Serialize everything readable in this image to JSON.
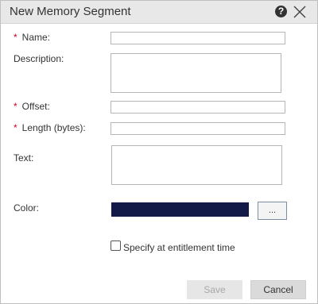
{
  "dialog": {
    "title": "New Memory Segment",
    "help_icon": "question-circle-icon",
    "help_glyph": "?",
    "close_icon": "close-x-icon"
  },
  "form": {
    "required_marker": "*",
    "name_label": "Name:",
    "name_value": "",
    "description_label": "Description:",
    "description_value": "",
    "offset_label": "Offset:",
    "offset_value": "",
    "length_label": "Length (bytes):",
    "length_value": "",
    "text_label": "Text:",
    "text_value": "",
    "color_label": "Color:",
    "color_value": "#131a48",
    "color_picker_label": "...",
    "specify_label": "Specify at entitlement time",
    "specify_checked": false
  },
  "buttons": {
    "save_label": "Save",
    "save_enabled": false,
    "cancel_label": "Cancel"
  }
}
